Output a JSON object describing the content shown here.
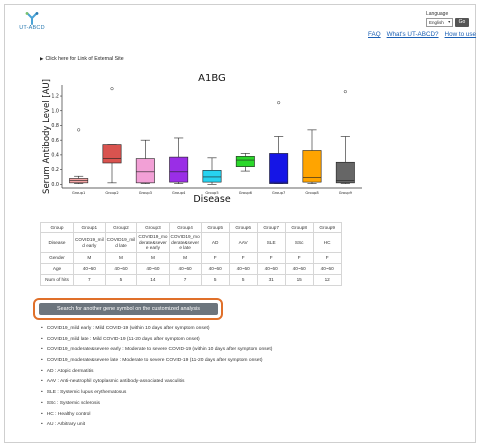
{
  "header": {
    "logo_text": "UT-ABCD",
    "language_label": "Language",
    "language_selected": "English",
    "go_label": "Go",
    "links": [
      "FAQ",
      "What's UT-ABCD?",
      "How to use"
    ]
  },
  "external_site_label": "Click here for Link of External Site",
  "chart_data": {
    "type": "box",
    "title": "A1BG",
    "xlabel": "Disease",
    "ylabel": "Serum Antibody Level [AU]",
    "ylim": [
      -0.05,
      1.35
    ],
    "yticks": [
      "0.0",
      "0.2",
      "0.4",
      "0.6",
      "0.8",
      "1.0",
      "1.2"
    ],
    "categories": [
      "Group1",
      "Group2",
      "Group3",
      "Group4",
      "Group5",
      "Group6",
      "Group7",
      "Group8",
      "Group9"
    ],
    "colors": [
      "#f4a4a4",
      "#d9534f",
      "#f2a0d6",
      "#9a2ee6",
      "#27d3f0",
      "#2bd82b",
      "#1515e6",
      "#ffa400",
      "#666666"
    ],
    "boxes": [
      {
        "min": 0.01,
        "q1": 0.02,
        "median": 0.05,
        "q3": 0.08,
        "max": 0.11,
        "outliers": [
          0.74
        ]
      },
      {
        "min": 0.02,
        "q1": 0.29,
        "median": 0.35,
        "q3": 0.54,
        "max": 0.54,
        "outliers": [
          1.3
        ]
      },
      {
        "min": 0.01,
        "q1": 0.02,
        "median": 0.17,
        "q3": 0.35,
        "max": 0.6,
        "outliers": []
      },
      {
        "min": 0.01,
        "q1": 0.03,
        "median": 0.17,
        "q3": 0.37,
        "max": 0.63,
        "outliers": []
      },
      {
        "min": 0.0,
        "q1": 0.03,
        "median": 0.1,
        "q3": 0.19,
        "max": 0.36,
        "outliers": []
      },
      {
        "min": 0.18,
        "q1": 0.24,
        "median": 0.33,
        "q3": 0.38,
        "max": 0.42,
        "outliers": []
      },
      {
        "min": 0.01,
        "q1": 0.01,
        "median": 0.03,
        "q3": 0.42,
        "max": 0.65,
        "outliers": [
          1.11
        ]
      },
      {
        "min": 0.01,
        "q1": 0.03,
        "median": 0.09,
        "q3": 0.46,
        "max": 0.74,
        "outliers": []
      },
      {
        "min": 0.01,
        "q1": 0.02,
        "median": 0.05,
        "q3": 0.3,
        "max": 0.65,
        "outliers": [
          1.26
        ]
      }
    ]
  },
  "table": {
    "columns": [
      "Group",
      "Group1",
      "Group2",
      "Group3",
      "Group4",
      "Group5",
      "Group6",
      "Group7",
      "Group8",
      "Group9"
    ],
    "disease": {
      "label": "Disease",
      "values": [
        [
          "COVID19_mil",
          "d early"
        ],
        [
          "COVID19_mil",
          "d late"
        ],
        [
          "COVID19_mo",
          "derate&sever",
          "e early"
        ],
        [
          "COVID19_mo",
          "derate&sever",
          "e late"
        ],
        [
          "AD"
        ],
        [
          "AAV"
        ],
        [
          "SLE"
        ],
        [
          "SSc"
        ],
        [
          "HC"
        ]
      ]
    },
    "rows": [
      {
        "label": "Gender",
        "values": [
          "M",
          "M",
          "M",
          "M",
          "F",
          "F",
          "F",
          "F",
          "F"
        ]
      },
      {
        "label": "Age",
        "values": [
          "40~60",
          "40~60",
          "40~60",
          "40~60",
          "40~60",
          "40~60",
          "40~60",
          "40~60",
          "40~60"
        ]
      },
      {
        "label": "Num of hits",
        "values": [
          "7",
          "5",
          "14",
          "7",
          "5",
          "5",
          "31",
          "15",
          "12"
        ]
      }
    ]
  },
  "search_button_label": "Search for another gene symbol on the customized analysis",
  "legend": [
    "COVID19_mild early : Mild COVID-19 (within 10 days after symptom onset)",
    "COVID19_mild late : Mild COVID-19 (11-20 days after symptom onset)",
    "COVID19_moderate&severe early : Moderate to severe COVID-19 (within 10 days after symptom onset)",
    "COVID19_moderate&severe late : Moderate to severe COVID-19 (11-20 days after symptom onset)",
    "AD : Atopic dermatitis",
    "AAV : Anti-neutrophil cytoplasmic antibody-associated vasculitis",
    "SLE : Systemic lupus erythematosus",
    "SSc : Systemic sclerosis",
    "HC : Healthy control"
  ],
  "au_note": "AU : Arbitrary unit"
}
